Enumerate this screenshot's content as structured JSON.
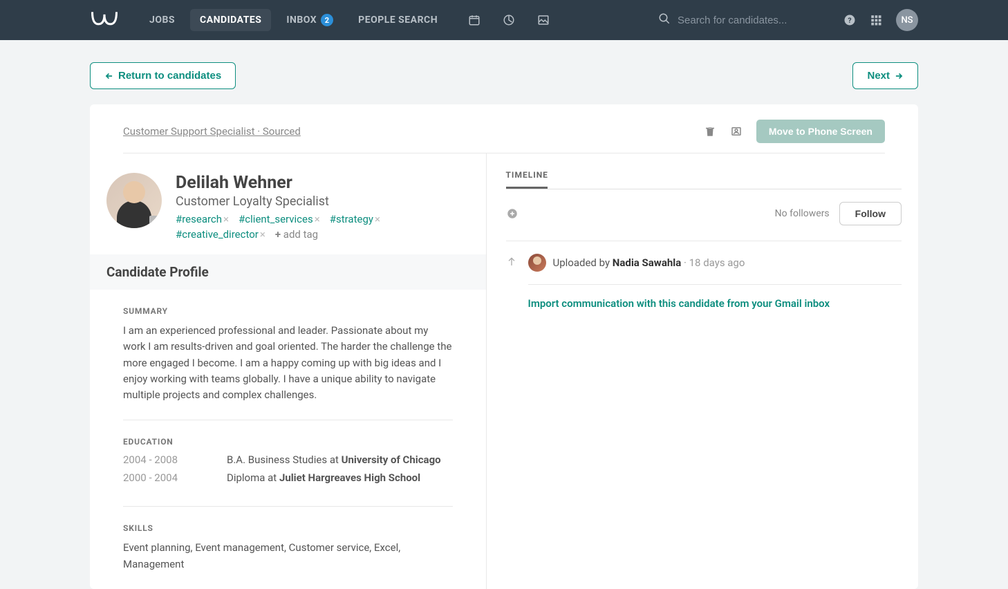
{
  "header": {
    "nav": {
      "jobs": "JOBS",
      "candidates": "CANDIDATES",
      "inbox": "INBOX",
      "inbox_badge": "2",
      "people_search": "PEOPLE SEARCH"
    },
    "search_placeholder": "Search for candidates...",
    "user_initials": "NS"
  },
  "actions": {
    "return": "Return to candidates",
    "next": "Next"
  },
  "card_header": {
    "breadcrumb": "Customer Support Specialist · Sourced",
    "move_button": "Move to Phone Screen"
  },
  "candidate": {
    "name": "Delilah Wehner",
    "title": "Customer Loyalty Specialist",
    "tags": [
      "#research",
      "#client_services",
      "#strategy",
      "#creative_director"
    ],
    "add_tag": "add tag"
  },
  "profile": {
    "heading": "Candidate Profile",
    "summary_label": "SUMMARY",
    "summary_text": "I am an experienced professional and leader. Passionate about my work I am results-driven and goal oriented. The harder the challenge the more engaged I become. I am a happy coming up with big ideas and I enjoy working with teams globally. I have a unique ability to navigate multiple projects and complex challenges.",
    "education_label": "EDUCATION",
    "education": [
      {
        "years": "2004 - 2008",
        "degree": "B.A. Business Studies at ",
        "school": "University of Chicago"
      },
      {
        "years": "2000 - 2004",
        "degree": "Diploma at ",
        "school": "Juliet Hargreaves High School"
      }
    ],
    "skills_label": "SKILLS",
    "skills_text": "Event planning, Event management, Customer service, Excel, Management"
  },
  "timeline": {
    "label": "TIMELINE",
    "no_followers": "No followers",
    "follow": "Follow",
    "uploaded_prefix": "Uploaded by ",
    "uploaded_by": "Nadia Sawahla",
    "uploaded_ago": " · 18 days ago",
    "import_link": "Import communication with this candidate from your Gmail inbox"
  }
}
